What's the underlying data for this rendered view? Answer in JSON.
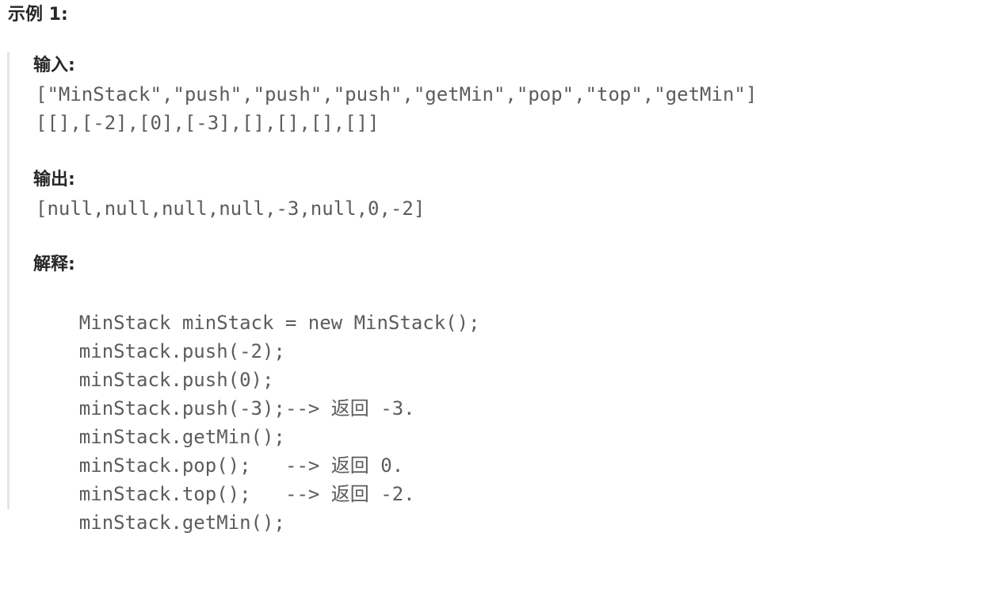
{
  "example": {
    "title": "示例 1:"
  },
  "input": {
    "label": "输入:",
    "lines": [
      "[\"MinStack\",\"push\",\"push\",\"push\",\"getMin\",\"pop\",\"top\",\"getMin\"]",
      "[[],[-2],[0],[-3],[],[],[],[]]"
    ]
  },
  "output": {
    "label": "输出:",
    "lines": [
      "[null,null,null,null,-3,null,0,-2]"
    ]
  },
  "explanation": {
    "label": "解释:",
    "lines": [
      {
        "code": "MinStack minStack = new MinStack();",
        "comment": ""
      },
      {
        "code": "minStack.push(-2);",
        "comment": ""
      },
      {
        "code": "minStack.push(0);",
        "comment": ""
      },
      {
        "code": "minStack.push(-3);",
        "comment": ""
      },
      {
        "code": "minStack.getMin();",
        "comment": "--> 返回 -3."
      },
      {
        "code": "minStack.pop();",
        "comment": ""
      },
      {
        "code": "minStack.top();",
        "comment": "--> 返回 0."
      },
      {
        "code": "minStack.getMin();",
        "comment": "--> 返回 -2."
      }
    ]
  }
}
